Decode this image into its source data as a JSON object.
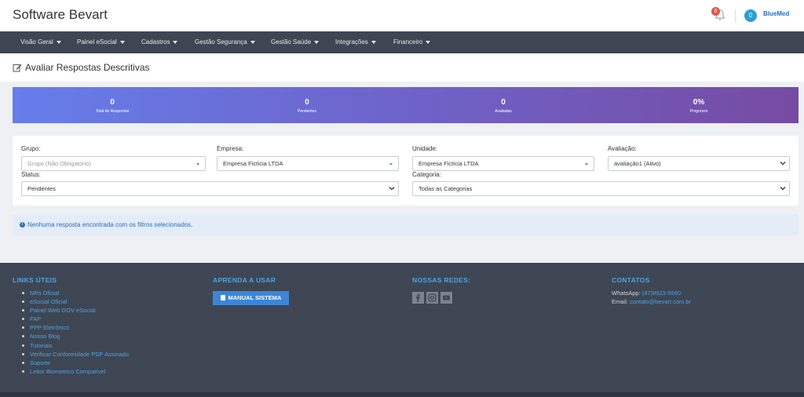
{
  "app": {
    "brand": "Software Bevart",
    "notification_count": "0",
    "company_count": "0",
    "company_logo_text": "BlueMed"
  },
  "nav": {
    "items": [
      {
        "label": "Visão Geral"
      },
      {
        "label": "Painel eSocial"
      },
      {
        "label": "Cadastros"
      },
      {
        "label": "Gestão Segurança"
      },
      {
        "label": "Gestão Saúde"
      },
      {
        "label": "Integrações"
      },
      {
        "label": "Financeiro"
      }
    ]
  },
  "page": {
    "title": "Avaliar Respostas Descritivas",
    "title_icon": "edit-icon"
  },
  "stats": [
    {
      "value": "0",
      "label": "Total de Respostas"
    },
    {
      "value": "0",
      "label": "Pendentes"
    },
    {
      "value": "0",
      "label": "Avaliadas"
    },
    {
      "value": "0%",
      "label": "Progresso"
    }
  ],
  "filters": {
    "grupo": {
      "label": "Grupo:",
      "placeholder": "Grupo (Não Obrigatório)"
    },
    "empresa": {
      "label": "Empresa:",
      "value": "Empresa Fictícia LTDA"
    },
    "unidade": {
      "label": "Unidade:",
      "value": "Empresa Fictícia LTDA"
    },
    "avaliacao": {
      "label": "Avaliação:",
      "value": "avaliação1 (Ativo)"
    },
    "status": {
      "label": "Status:",
      "value": "Pendentes"
    },
    "categoria": {
      "label": "Categoria:",
      "value": "Todas as Categorias"
    }
  },
  "alert": {
    "text": "Nenhuma resposta encontrada com os filtros selecionados."
  },
  "footer": {
    "links_heading": "LINKS ÚTEIS",
    "links": [
      "NRs Oficial",
      "eSocial Oficial",
      "Painel Web GOV eSocial",
      "FAP",
      "PPP Eletrônico",
      "Nosso Blog",
      "Tutoriais",
      "Verificar Conformidade PDF Assinado",
      "Suporte",
      "Leitor Biometrico Compatível"
    ],
    "learn_heading": "APRENDA A USAR",
    "manual_button": "MANUAL SISTEMA",
    "social_heading": "NOSSAS REDES:",
    "social_icons": [
      "facebook-icon",
      "instagram-icon",
      "youtube-icon"
    ],
    "contacts_heading": "CONTATOS",
    "whatsapp_label": "WhatsApp:",
    "whatsapp_value": "(47)8923-5660",
    "email_label": "Email:",
    "email_value": "contato@bevart.com.br"
  },
  "colors": {
    "navbar": "#3e4653",
    "stats_gradient_start": "#667eea",
    "stats_gradient_end": "#764ba2",
    "link": "#4ca3e6",
    "alert_bg": "#e3ecf7"
  }
}
